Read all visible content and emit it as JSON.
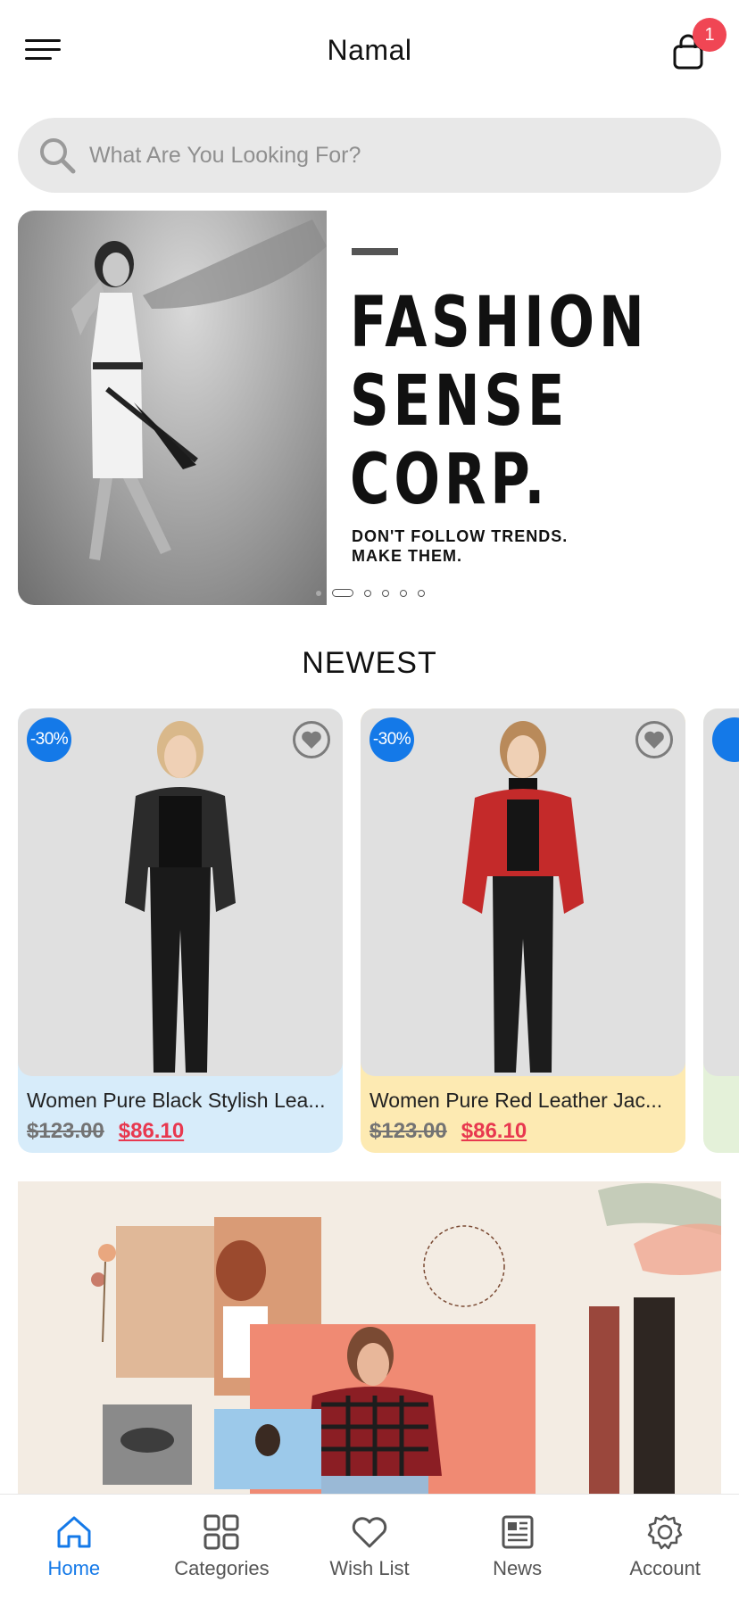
{
  "header": {
    "title": "Namal",
    "cart_count": "1",
    "menu_icon": "hamburger-menu-icon",
    "cart_icon": "shopping-bag-icon"
  },
  "search": {
    "placeholder": "What Are You Looking For?"
  },
  "hero": {
    "headline": "FASHION\nSENSE\nCORP.",
    "tagline": "DON'T FOLLOW TRENDS.\nMAKE THEM.",
    "slide_count": 6,
    "active_slide": 1
  },
  "section": {
    "title": "NEWEST"
  },
  "products": [
    {
      "name": "Women Pure Black Stylish Lea...",
      "discount": "-30%",
      "old_price": "$123.00",
      "new_price": "$86.10",
      "info_bg": "#d7ecfa",
      "jacket_color": "#2b2b2b"
    },
    {
      "name": "Women Pure Red Leather Jac...",
      "discount": "-30%",
      "old_price": "$123.00",
      "new_price": "$86.10",
      "info_bg": "#fdeab2",
      "jacket_color": "#c42a2a"
    }
  ],
  "collection_banner": {
    "accent": "#f08a73",
    "background": "#f3ece3"
  },
  "bottom_nav": {
    "items": [
      {
        "label": "Home",
        "icon": "home-icon",
        "active": true
      },
      {
        "label": "Categories",
        "icon": "grid-icon",
        "active": false
      },
      {
        "label": "Wish List",
        "icon": "heart-icon",
        "active": false
      },
      {
        "label": "News",
        "icon": "newspaper-icon",
        "active": false
      },
      {
        "label": "Account",
        "icon": "gear-icon",
        "active": false
      }
    ]
  },
  "colors": {
    "accent": "#1479e8",
    "sale": "#e8384f",
    "badge": "#f04654"
  }
}
